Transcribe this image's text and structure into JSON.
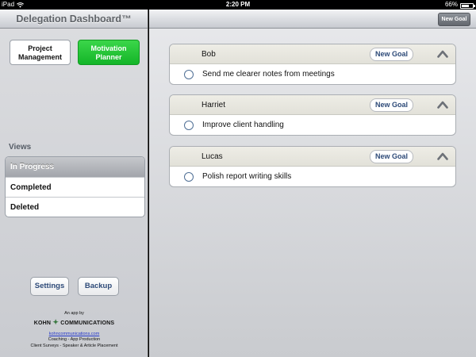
{
  "status_bar": {
    "device": "iPad",
    "wifi_icon": "wifi-icon",
    "time": "2:20 PM",
    "battery_percent": "66%",
    "battery_level": 0.66
  },
  "sidebar": {
    "title": "Delegation Dashboard™",
    "project_management_label": "Project\nManagement",
    "motivation_planner_label": "Motivation\nPlanner",
    "views_label": "Views",
    "views": [
      {
        "label": "In Progress",
        "selected": true
      },
      {
        "label": "Completed",
        "selected": false
      },
      {
        "label": "Deleted",
        "selected": false
      }
    ],
    "settings_label": "Settings",
    "backup_label": "Backup",
    "footer": {
      "app_by": "An app by",
      "logo_left": "KOHN",
      "logo_right": "COMMUNICATIONS",
      "url": "kohncommunications.com",
      "line1": "Coaching - App Production",
      "line2": "Client Surveys - Speaker & Article Placement"
    }
  },
  "main": {
    "new_goal_top_label": "New Goal",
    "people": [
      {
        "name": "Bob",
        "new_goal_label": "New Goal",
        "goal": "Send me clearer notes from meetings"
      },
      {
        "name": "Harriet",
        "new_goal_label": "New Goal",
        "goal": "Improve client handling"
      },
      {
        "name": "Lucas",
        "new_goal_label": "New Goal",
        "goal": "Polish report writing skills"
      }
    ]
  },
  "colors": {
    "green_button": "#1fbf33",
    "link_blue": "#2d4a78",
    "circle_blue": "#4f6f95"
  }
}
